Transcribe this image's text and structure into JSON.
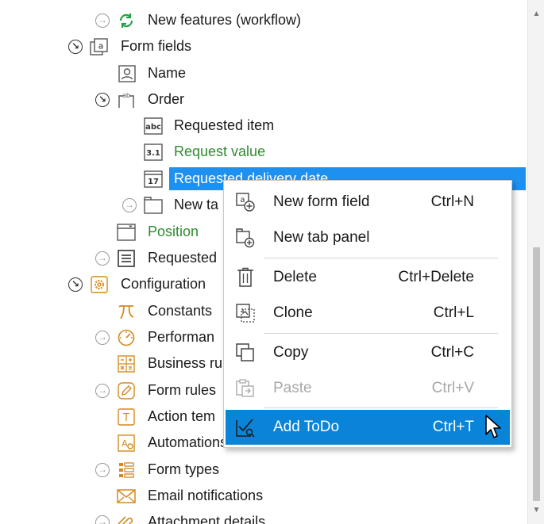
{
  "tree": {
    "items": [
      {
        "label": "New features (workflow)",
        "icon": "workflow-refresh-icon"
      },
      {
        "label": "Form fields",
        "icon": "form-fields-icon"
      },
      {
        "label": "Name",
        "icon": "user-field-icon"
      },
      {
        "label": "Order",
        "icon": "group-field-icon"
      },
      {
        "label": "Requested item",
        "icon": "text-field-icon",
        "icon_text": "abc"
      },
      {
        "label": "Request value",
        "icon": "number-field-icon",
        "icon_text": "3.1"
      },
      {
        "label": "Requested delivery date",
        "icon": "date-field-icon",
        "icon_text": "17"
      },
      {
        "label": "New ta",
        "icon": "tab-panel-icon"
      },
      {
        "label": "Position",
        "icon": "dropdown-field-icon"
      },
      {
        "label": "Requested",
        "icon": "list-field-icon"
      },
      {
        "label": "Configuration",
        "icon": "configuration-gear-icon"
      },
      {
        "label": "Constants",
        "icon": "pi-icon"
      },
      {
        "label": "Performan",
        "icon": "speedometer-icon"
      },
      {
        "label": "Business ru",
        "icon": "calculator-icon"
      },
      {
        "label": "Form rules",
        "icon": "pencil-icon"
      },
      {
        "label": "Action tem",
        "icon": "action-template-icon",
        "icon_text": "T"
      },
      {
        "label": "Automations",
        "icon": "automation-icon"
      },
      {
        "label": "Form types",
        "icon": "form-types-list-icon"
      },
      {
        "label": "Email notifications",
        "icon": "envelope-icon"
      },
      {
        "label": "Attachment details",
        "icon": "paperclip-icon"
      }
    ]
  },
  "context_menu": {
    "items": [
      {
        "label": "New form field",
        "shortcut": "Ctrl+N",
        "icon": "new-form-field-icon"
      },
      {
        "label": "New tab panel",
        "shortcut": "",
        "icon": "new-tab-panel-icon"
      },
      {
        "label": "Delete",
        "shortcut": "Ctrl+Delete",
        "icon": "trash-icon"
      },
      {
        "label": "Clone",
        "shortcut": "Ctrl+L",
        "icon": "clone-icon"
      },
      {
        "label": "Copy",
        "shortcut": "Ctrl+C",
        "icon": "copy-icon"
      },
      {
        "label": "Paste",
        "shortcut": "Ctrl+V",
        "icon": "paste-icon",
        "disabled": true
      },
      {
        "label": "Add ToDo",
        "shortcut": "Ctrl+T",
        "icon": "add-todo-icon",
        "highlighted": true
      }
    ]
  },
  "colors": {
    "selection": "#1e90f0",
    "menu_highlight": "#0a84d8",
    "green_text": "#2e8b2e",
    "refresh_green": "#22a04a",
    "config_orange": "#d48a1e"
  }
}
